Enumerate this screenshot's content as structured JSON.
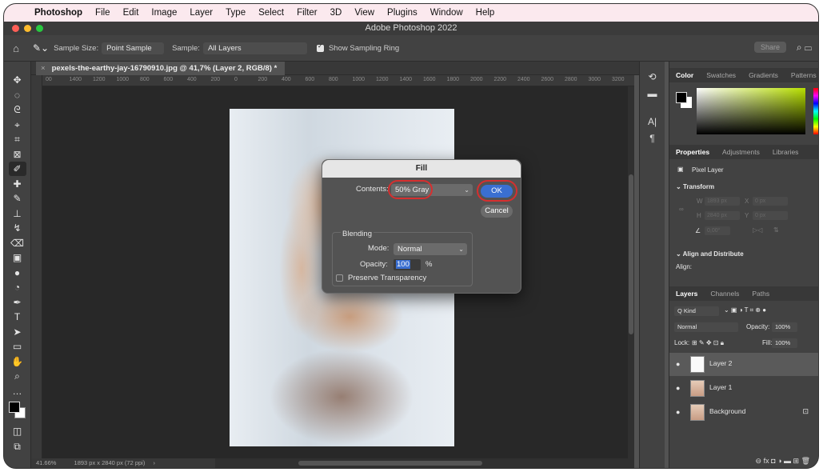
{
  "menubar": {
    "app_name": "Photoshop",
    "items": [
      "File",
      "Edit",
      "Image",
      "Layer",
      "Type",
      "Select",
      "Filter",
      "3D",
      "View",
      "Plugins",
      "Window",
      "Help"
    ]
  },
  "window": {
    "title": "Adobe Photoshop 2022"
  },
  "options_bar": {
    "sample_size_label": "Sample Size:",
    "sample_size_value": "Point Sample",
    "sample_label": "Sample:",
    "sample_value": "All Layers",
    "show_sampling_ring": "Show Sampling Ring",
    "share": "Share"
  },
  "document": {
    "tab_title": "pexels-the-earthy-jay-16790910.jpg @ 41,7% (Layer 2, RGB/8) *",
    "ruler_ticks": [
      "00",
      "1400",
      "1200",
      "1000",
      "800",
      "600",
      "400",
      "200",
      "0",
      "200",
      "400",
      "600",
      "800",
      "1000",
      "1200",
      "1400",
      "1600",
      "1800",
      "2000",
      "2200",
      "2400",
      "2600",
      "2800",
      "3000",
      "3200"
    ]
  },
  "status": {
    "zoom": "41.66%",
    "dimensions": "1893 px x 2840 px (72 ppi)"
  },
  "fill_dialog": {
    "title": "Fill",
    "contents_label": "Contents:",
    "contents_value": "50% Gray",
    "ok": "OK",
    "cancel": "Cancel",
    "blending_label": "Blending",
    "mode_label": "Mode:",
    "mode_value": "Normal",
    "opacity_label": "Opacity:",
    "opacity_value": "100",
    "opacity_unit": "%",
    "preserve_transparency": "Preserve Transparency"
  },
  "color_panel": {
    "tabs": [
      "Color",
      "Swatches",
      "Gradients",
      "Patterns"
    ]
  },
  "properties_panel": {
    "tabs": [
      "Properties",
      "Adjustments",
      "Libraries"
    ],
    "layer_kind": "Pixel Layer",
    "transform_label": "Transform",
    "w_label": "W",
    "w_value": "1893 px",
    "x_label": "X",
    "x_value": "0 px",
    "h_label": "H",
    "h_value": "2840 px",
    "y_label": "Y",
    "y_value": "0 px",
    "angle_value": "0,00°",
    "align_label": "Align and Distribute",
    "align_sub": "Align:"
  },
  "layers_panel": {
    "tabs": [
      "Layers",
      "Channels",
      "Paths"
    ],
    "kind_filter": "Q Kind",
    "blend_mode": "Normal",
    "opacity_label": "Opacity:",
    "opacity_value": "100%",
    "lock_label": "Lock:",
    "fill_label": "Fill:",
    "fill_value": "100%",
    "layers": [
      {
        "name": "Layer 2"
      },
      {
        "name": "Layer 1"
      },
      {
        "name": "Background"
      }
    ]
  },
  "colors": {
    "accent": "#3a6fd1",
    "highlight_ring": "#d62f2f"
  }
}
